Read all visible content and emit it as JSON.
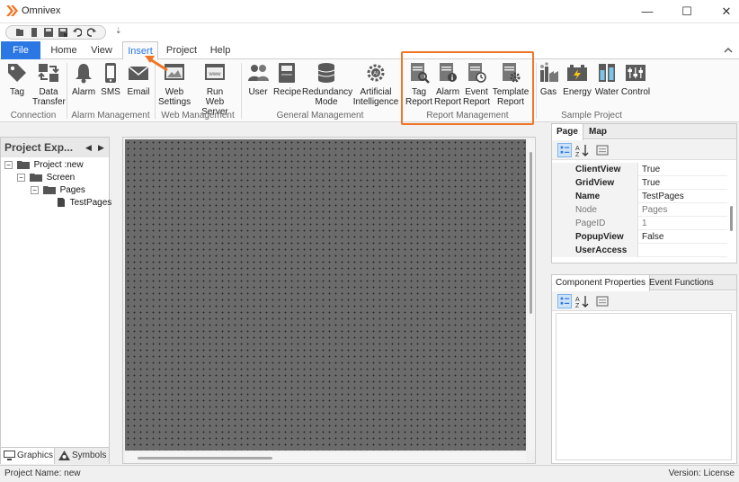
{
  "window": {
    "title": "Omnivex",
    "minimize_glyph": "—",
    "maximize_glyph": "☐",
    "close_glyph": "✕"
  },
  "quick_access": {
    "items": [
      "new-icon",
      "open-icon",
      "save-icon",
      "save-all-icon",
      "undo-icon",
      "redo-icon"
    ],
    "customize_glyph": "⇣"
  },
  "menu": {
    "tabs": [
      {
        "label": "File"
      },
      {
        "label": "Home"
      },
      {
        "label": "View"
      },
      {
        "label": "Insert"
      },
      {
        "label": "Project"
      },
      {
        "label": "Help"
      }
    ],
    "active_tab": "Insert"
  },
  "ribbon": {
    "groups": [
      {
        "label": "Connection",
        "buttons": [
          {
            "line1": "Tag",
            "line2": ""
          },
          {
            "line1": "Data",
            "line2": "Transfer"
          }
        ]
      },
      {
        "label": "Alarm Management",
        "buttons": [
          {
            "line1": "Alarm",
            "line2": ""
          },
          {
            "line1": "SMS",
            "line2": ""
          },
          {
            "line1": "Email",
            "line2": ""
          }
        ]
      },
      {
        "label": "Web Management",
        "buttons": [
          {
            "line1": "Web",
            "line2": "Settings"
          },
          {
            "line1": "Run",
            "line2": "Web Server"
          }
        ]
      },
      {
        "label": "General Management",
        "buttons": [
          {
            "line1": "User",
            "line2": ""
          },
          {
            "line1": "Recipe",
            "line2": ""
          },
          {
            "line1": "Redundancy",
            "line2": "Mode"
          },
          {
            "line1": "Artificial",
            "line2": "Intelligence"
          }
        ]
      },
      {
        "label": "Report Management",
        "buttons": [
          {
            "line1": "Tag",
            "line2": "Report"
          },
          {
            "line1": "Alarm",
            "line2": "Report"
          },
          {
            "line1": "Event",
            "line2": "Report"
          },
          {
            "line1": "Template",
            "line2": "Report"
          }
        ]
      },
      {
        "label": "Sample Project",
        "buttons": [
          {
            "line1": "Gas",
            "line2": ""
          },
          {
            "line1": "Energy",
            "line2": ""
          },
          {
            "line1": "Water",
            "line2": ""
          },
          {
            "line1": "Control",
            "line2": ""
          }
        ]
      }
    ],
    "highlight_color": "#f07524",
    "accent_color": "#2b78e4"
  },
  "project_explorer": {
    "title": "Project Exp...",
    "nav_prev": "◀",
    "nav_next": "▶",
    "tree": [
      {
        "label": "Project :new",
        "toggle": "−"
      },
      {
        "label": "Screen",
        "toggle": "−"
      },
      {
        "label": "Pages",
        "toggle": "−"
      },
      {
        "label": "TestPages",
        "toggle": ""
      }
    ],
    "tabs": [
      {
        "label": "Graphics"
      },
      {
        "label": "Symbols"
      }
    ]
  },
  "properties": {
    "tabs": [
      {
        "label": "Page"
      },
      {
        "label": "Map"
      }
    ],
    "rows": [
      {
        "name": "ClientView",
        "value": "True",
        "bold": true
      },
      {
        "name": "GridView",
        "value": "True",
        "bold": true
      },
      {
        "name": "Name",
        "value": "TestPages",
        "bold": true
      },
      {
        "name": "Node",
        "value": "Pages",
        "bold": false
      },
      {
        "name": "PageID",
        "value": "1",
        "bold": false
      },
      {
        "name": "PopupView",
        "value": "False",
        "bold": true
      },
      {
        "name": "UserAccess",
        "value": "",
        "bold": true
      }
    ]
  },
  "component_panel": {
    "tabs": [
      {
        "label": "Component Properties"
      },
      {
        "label": "Event Functions"
      }
    ]
  },
  "status": {
    "project_name": "Project Name: new",
    "version": "Version: License"
  }
}
